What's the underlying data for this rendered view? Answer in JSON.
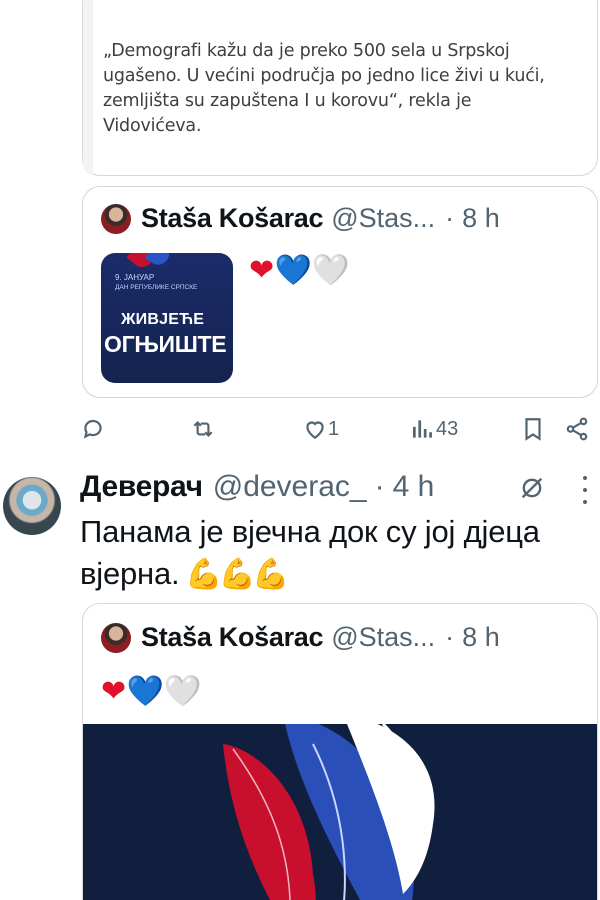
{
  "article": {
    "text": "„Demografi kažu da je preko 500 sela u Srpskoj ugašeno. U većini područja po jedno lice živi u kući, zemljišta su zapuštena I u korovu“, rekla je Vidovićeva."
  },
  "quoted_tweet_1": {
    "author_name": "Staša Košarac",
    "handle": "@Stas...",
    "dot": "·",
    "time": "8 h",
    "hearts": [
      "❤",
      "💙",
      "🤍"
    ],
    "media": {
      "small_line_1": "9. ЈАНУАР",
      "small_line_2": "ДАН РЕПУБЛИКЕ СРПСКЕ",
      "big_line_1": "ЖИВЈЕЋЕ",
      "big_line_2": "ОГЊИШТЕ"
    }
  },
  "actions": {
    "reply_icon": "reply-icon",
    "retweet_icon": "retweet-icon",
    "like_count": "1",
    "views_count": "43",
    "bookmark_icon": "bookmark-icon",
    "share_icon": "share-icon"
  },
  "tweet_2": {
    "author_name": "Деверач",
    "handle": "@deverac_",
    "dot": "·",
    "time": "4 h",
    "text": "Панама је вјечна док су јој дјеца вјерна.",
    "emoji": "💪💪💪"
  },
  "quoted_tweet_2": {
    "author_name": "Staša Košarac",
    "handle": "@Stas...",
    "dot": "·",
    "time": "8 h",
    "hearts": [
      "❤",
      "💙",
      "🤍"
    ]
  },
  "colors": {
    "text_primary": "#0f1419",
    "text_secondary": "#536471",
    "border": "#cfd9de",
    "media_bg": "#111f3e",
    "flag_red": "#c8102e",
    "flag_blue": "#1c3f94"
  }
}
